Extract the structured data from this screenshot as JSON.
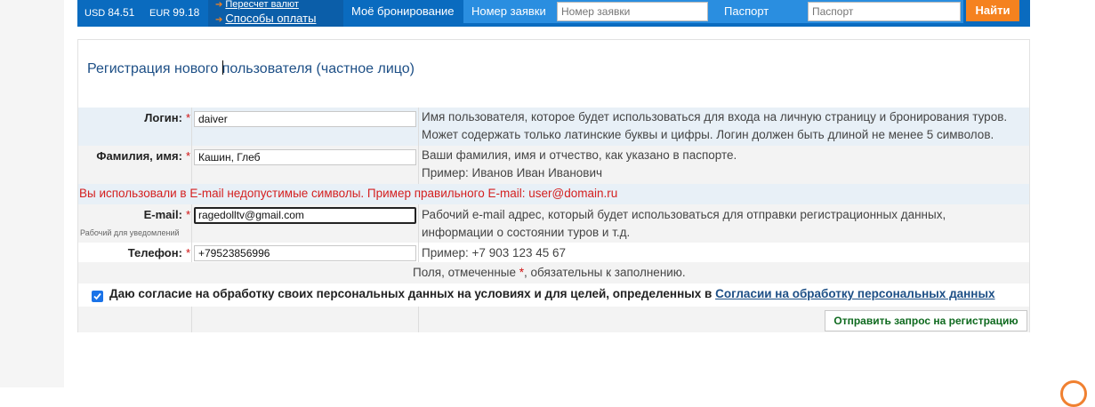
{
  "header": {
    "currency_usd_label": "USD",
    "currency_usd_value": "84.51",
    "currency_eur_label": "EUR",
    "currency_eur_value": "99.18",
    "link_recalc": "Пересчет валют",
    "link_payment": "Способы оплаты",
    "my_booking": "Моё бронирование",
    "order_label": "Номер заявки",
    "order_placeholder": "Номер заявки",
    "passport_label": "Паспорт",
    "passport_placeholder": "Паспорт",
    "find_button": "Найти"
  },
  "form": {
    "title": "Регистрация нового пользователя (частное лицо)",
    "required_mark": "*",
    "login": {
      "label": "Логин:",
      "value": "daiver",
      "help_line1": "Имя пользователя, которое будет использоваться для входа на личную страницу и бронирования туров.",
      "help_line2": "Может содержать только латинские буквы и цифры. Логин должен быть длиной не менее 5 символов."
    },
    "fullname": {
      "label": "Фамилия, имя:",
      "value": "Кашин, Глеб",
      "help_line1": "Ваши фамилия, имя и отчество, как указано в паспорте.",
      "help_line2": "Пример: Иванов Иван Иванович"
    },
    "email_error": "Вы использовали в E-mail недопустимые символы. Пример правильного E-mail: user@domain.ru",
    "email": {
      "label": "E-mail:",
      "sublabel": "Рабочий для уведомлений",
      "value": "ragedolltv@gmail.com",
      "help_line1": "Рабочий e-mail адрес, который будет использоваться для отправки регистрационных данных,",
      "help_line2": "информации о состоянии туров и т.д."
    },
    "phone": {
      "label": "Телефон:",
      "value": "+79523856996",
      "help_line1": "Пример: +7 903 123 45 67"
    },
    "required_note_before": "Поля, отмеченные ",
    "required_note_after": ", обязательны к заполнению.",
    "consent_text": "Даю согласие на обработку своих персональных данных на условиях и для целей, определенных в ",
    "consent_link": "Согласии на обработку персональных данных",
    "consent_checked": true,
    "submit_button": "Отправить запрос на регистрацию"
  },
  "colors": {
    "topbar": "#0a6bbf",
    "accent_orange": "#f5821f",
    "error_red": "#d42020",
    "title_blue": "#1d4f86",
    "submit_green": "#0f6a1f"
  }
}
